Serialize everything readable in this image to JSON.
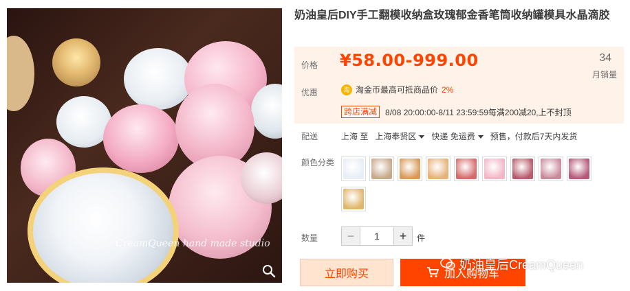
{
  "product": {
    "title": "奶油皇后DIY手工翻模收纳盒玫瑰郁金香笔筒收纳罐模具水晶滴胶",
    "image_watermark": "CreamQueen hand made studio"
  },
  "price": {
    "label": "价格",
    "value": "¥58.00-999.00",
    "monthly_sales": "34",
    "monthly_sales_label": "月销量"
  },
  "promotion": {
    "label": "优惠",
    "coin_text": "淘金币最高可抵商品价",
    "coin_pct": "2%",
    "coin_icon_text": "淘",
    "tag": "跨店满减",
    "detail": "8/08 20:00:00-8/11 23:59:59每满200减20,上不封顶"
  },
  "shipping": {
    "label": "配送",
    "from": "上海 至",
    "to": "上海奉贤区",
    "method": "快递 免运费",
    "presale": "预售，付款后7天内发货"
  },
  "colors": {
    "label": "颜色分类",
    "swatches": [
      {
        "name": "swatch-1",
        "color": "#e8eef6"
      },
      {
        "name": "swatch-2",
        "color": "#c7a98a"
      },
      {
        "name": "swatch-3",
        "color": "#d79a5a"
      },
      {
        "name": "swatch-4",
        "color": "#e6b27a"
      },
      {
        "name": "swatch-5",
        "color": "#d66b6b"
      },
      {
        "name": "swatch-6",
        "color": "#f2b6c6"
      },
      {
        "name": "swatch-7",
        "color": "#b85c6c"
      },
      {
        "name": "swatch-8",
        "color": "#c98b9c"
      },
      {
        "name": "swatch-9",
        "color": "#b65a78"
      },
      {
        "name": "swatch-10",
        "color": "#e0b66a"
      }
    ]
  },
  "quantity": {
    "label": "数量",
    "value": "1",
    "minus": "−",
    "plus": "+",
    "unit": "件"
  },
  "actions": {
    "buy_now": "立即购买",
    "add_to_cart": "加入购物车"
  },
  "overlay": {
    "wechat_account": "奶油皇后CreamQueen"
  },
  "colors_theme": {
    "accent": "#ff4400",
    "price_bg": "#fff2e8"
  }
}
